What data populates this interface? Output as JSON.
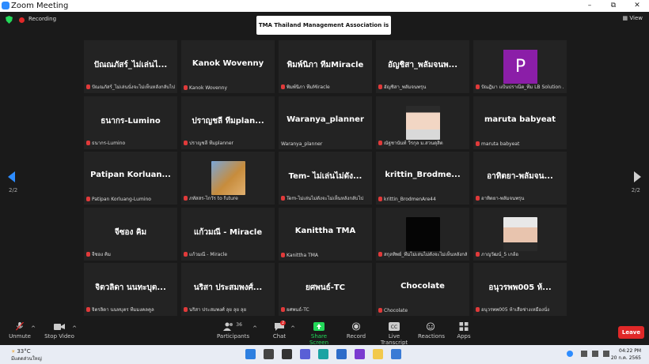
{
  "window": {
    "title": "Zoom Meeting",
    "min": "–",
    "max": "⧉",
    "close": "✕"
  },
  "status": {
    "recording": "Recording",
    "talking": "TMA Thailand Management Association is talking...",
    "view": "View"
  },
  "pager": {
    "left": "2/2",
    "right": "2/2"
  },
  "tiles": [
    {
      "big": "ปัณณภัสร์_ไม่เล่นไ...",
      "cap": "ปัณณภัสร์_ไม่เล่นนั่งจะไม่เห็นหลังกลับไป"
    },
    {
      "big": "Kanok Wovenny",
      "cap": "Kanok Wovenny"
    },
    {
      "big": "พิมพ์นิภา ทีมMiracle",
      "cap": "พิมพ์นิภา ทีมMiracle"
    },
    {
      "big": "อัญชิสา_พลัมจนพ...",
      "cap": "อัญชิสา_พลัมจนพรุน"
    },
    {
      "big": "P",
      "cap": "ปัณฎิมา แป้นปราณีต_ทีม LB Solution ..."
    },
    {
      "big": "ธนากร-Lumino",
      "cap": "ธนากร-Lumino"
    },
    {
      "big": "ปราญชลี ทีมplan...",
      "cap": "ปราญชลี ทีมplanner"
    },
    {
      "big": "Waranya_planner",
      "cap": "Waranya_planner"
    },
    {
      "big": "",
      "cap": "ณัฐชานันท์ วีรกุล ม.สวนดุสิต"
    },
    {
      "big": "maruta babyeat",
      "cap": "maruta babyeat"
    },
    {
      "big": "Patipan Korluan...",
      "cap": "Patipan Korluang-Lumino"
    },
    {
      "big": "",
      "cap": "ภทัสสร-ไกวัร to future"
    },
    {
      "big": "Tem- ไม่เล่นไม่ดัง...",
      "cap": "Tem-ไม่เล่นไม่ดังจะไม่เห็นหลังกลับไป"
    },
    {
      "big": "krittin_Brodme...",
      "cap": "krittin_BrodmenAre44"
    },
    {
      "big": "อาทิตยา-พลัมจน...",
      "cap": "อาทิตยา-พลัมจนพรุน"
    },
    {
      "big": "จีซอง คิม",
      "cap": "จีซอง คิม"
    },
    {
      "big": "แก้วมณี - Miracle",
      "cap": "แก้วมณี - Miracle"
    },
    {
      "big": "Kanittha TMA",
      "cap": "Kanittha TMA"
    },
    {
      "big": "",
      "cap": "สกุลทิพย์_ทีมไม่เล่นไม่ดังจะไม่เห็นหลังกลับไป"
    },
    {
      "big": "",
      "cap": "ภาญวัฒน์_5 เกล้อ"
    },
    {
      "big": "จิตวลิดา นนทะบุต...",
      "cap": "จิตรลิดา นนทบุตร ทีมมงคลคูล"
    },
    {
      "big": "นริสา ประสมพงศ์...",
      "cap": "นริสา ประสมพงศ์ ลุย ลุย ลุย"
    },
    {
      "big": "ยศพนธ์-TC",
      "cap": "ยศพนธ์-TC"
    },
    {
      "big": "Chocolate",
      "cap": "Chocolate"
    },
    {
      "big": "อนุวรพพ005 ห้...",
      "cap": "อนุวรพพ005 ห้าเสือช่างเหมืองนั่ง"
    }
  ],
  "toolbar": {
    "unmute": "Unmute",
    "stop_video": "Stop Video",
    "participants": "Participants",
    "participants_count": "36",
    "chat": "Chat",
    "chat_badge": "2",
    "share": "Share Screen",
    "record": "Record",
    "transcript": "Live Transcript",
    "reactions": "Reactions",
    "apps": "Apps",
    "leave": "Leave"
  },
  "taskbar": {
    "temp": "33°C",
    "weather": "มีแดดส่วนใหญ่",
    "time": "04:22 PM",
    "date": "20 ก.ค. 2565"
  },
  "colors": {
    "zoom_blue": "#2d8cff",
    "leave_red": "#e02828",
    "share_green": "#23d959"
  }
}
